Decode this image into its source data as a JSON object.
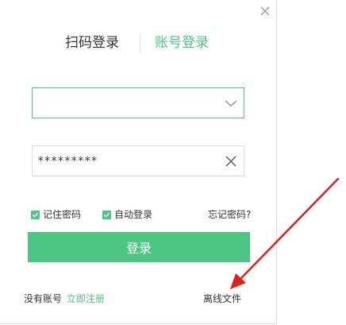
{
  "dialog": {
    "close_icon": "close-icon",
    "tabs": {
      "qr_login": "扫码登录",
      "account_login": "账号登录",
      "active": "account_login"
    },
    "username": {
      "value": "",
      "placeholder": "",
      "dropdown_icon": "chevron-down-icon"
    },
    "password": {
      "value": "*********",
      "clear_icon": "clear-icon"
    },
    "options": {
      "remember_password": "记住密码",
      "remember_checked": true,
      "auto_login": "自动登录",
      "auto_login_checked": true,
      "forgot_password": "忘记密码?"
    },
    "login_button": "登录",
    "footer": {
      "no_account": "没有账号",
      "register": "立即注册",
      "offline_files": "离线文件"
    }
  },
  "annotation": {
    "arrow_color": "#e02020",
    "arrow_icon": "red-arrow-annotation"
  },
  "colors": {
    "accent": "#4ec683",
    "text": "#333333",
    "border": "#dddddd"
  }
}
